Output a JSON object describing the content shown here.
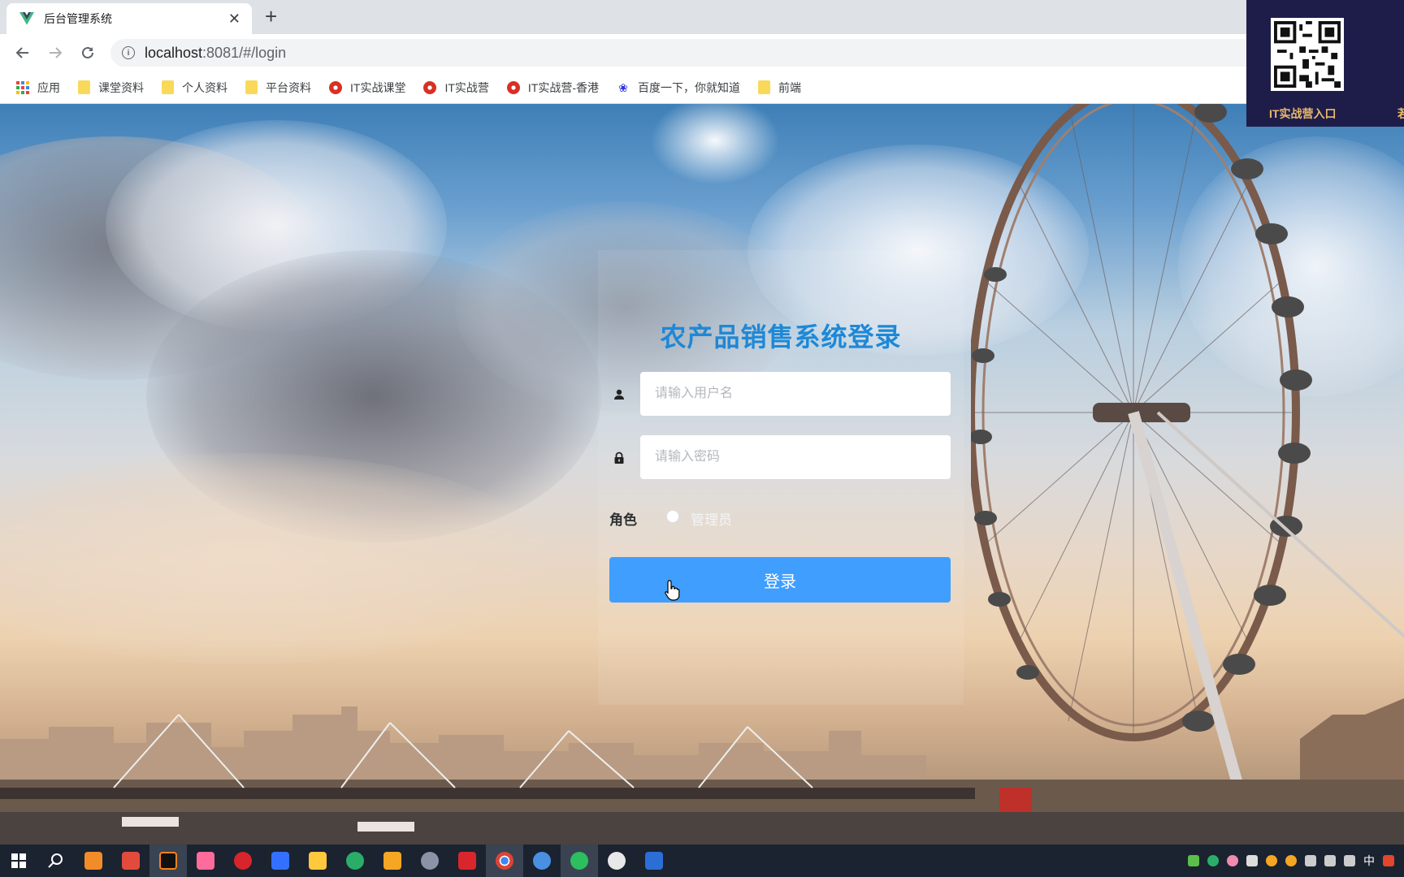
{
  "browser": {
    "tab_title": "后台管理系统",
    "tab_close": "✕",
    "new_tab": "+",
    "url_host": "localhost",
    "url_rest": ":8081/#/login",
    "bookmarks": [
      {
        "label": "应用",
        "icon": "apps-icon"
      },
      {
        "label": "课堂资料",
        "icon": "folder-icon"
      },
      {
        "label": "个人资料",
        "icon": "folder-icon"
      },
      {
        "label": "平台资料",
        "icon": "folder-icon"
      },
      {
        "label": "IT实战课堂",
        "icon": "chrome-icon"
      },
      {
        "label": "IT实战营",
        "icon": "chrome-icon"
      },
      {
        "label": "IT实战营-香港",
        "icon": "chrome-icon"
      },
      {
        "label": "百度一下，你就知道",
        "icon": "baidu-icon"
      },
      {
        "label": "前端",
        "icon": "folder-icon"
      }
    ]
  },
  "overlay": {
    "qr_label": "IT实战营入口",
    "qr_label_partial": "若"
  },
  "login": {
    "title": "农产品销售系统登录",
    "username_placeholder": "请输入用户名",
    "password_placeholder": "请输入密码",
    "role_label": "角色",
    "role_option": "管理员",
    "submit_label": "登录"
  },
  "taskbar": {
    "ime": "中"
  },
  "colors": {
    "primary": "#409eff",
    "title": "#1e88d6",
    "qr_bg": "#1e1d4a",
    "qr_text": "#e9b86b"
  }
}
